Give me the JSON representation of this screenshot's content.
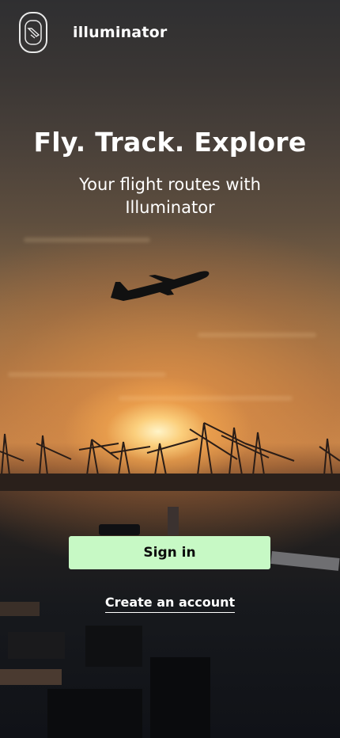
{
  "header": {
    "logo_icon": "airplane-window-icon",
    "brand": "illuminator"
  },
  "hero": {
    "title": "Fly. Track. Explore",
    "subtitle": "Your flight routes with\nIlluminator"
  },
  "actions": {
    "signin_label": "Sign in",
    "create_account_label": "Create an account"
  },
  "colors": {
    "signin_bg": "#c7f9c5",
    "signin_text": "#0c0c0c",
    "text": "#ffffff"
  }
}
